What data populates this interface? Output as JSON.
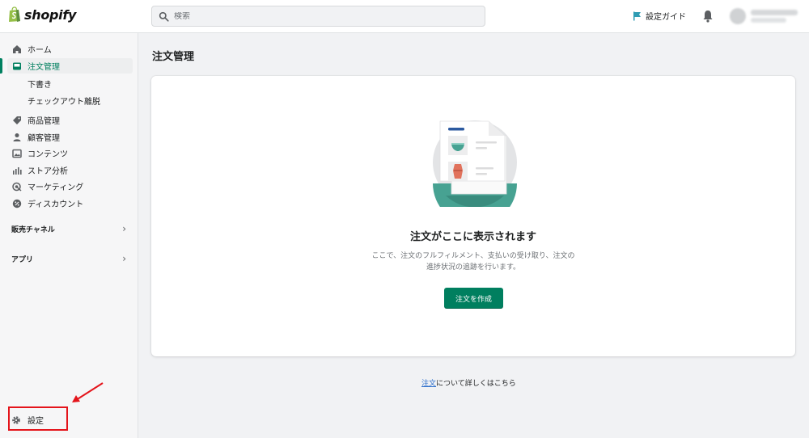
{
  "brand": {
    "name": "shopify"
  },
  "search": {
    "placeholder": "検索"
  },
  "topbar": {
    "setup_guide": "設定ガイド"
  },
  "sidebar": {
    "items": [
      {
        "label": "ホーム",
        "icon": "home-icon"
      },
      {
        "label": "注文管理",
        "icon": "orders-icon",
        "active": true
      },
      {
        "label": "商品管理",
        "icon": "tag-icon"
      },
      {
        "label": "顧客管理",
        "icon": "customer-icon"
      },
      {
        "label": "コンテンツ",
        "icon": "content-icon"
      },
      {
        "label": "ストア分析",
        "icon": "analytics-icon"
      },
      {
        "label": "マーケティング",
        "icon": "marketing-icon"
      },
      {
        "label": "ディスカウント",
        "icon": "discount-icon"
      }
    ],
    "sub_items": [
      "下書き",
      "チェックアウト離脱"
    ],
    "sections": [
      "販売チャネル",
      "アプリ"
    ],
    "settings_label": "設定"
  },
  "main": {
    "title": "注文管理",
    "empty_state": {
      "heading": "注文がここに表示されます",
      "description_line1": "ここで、注文のフルフィルメント、支払いの受け取り、注文の",
      "description_line2": "進捗状況の追跡を行います。",
      "button": "注文を作成"
    },
    "learn_more": {
      "link": "注文",
      "suffix": "について詳しくはこちら"
    }
  },
  "colors": {
    "accent": "#007f5f",
    "highlight": "#e4141b",
    "link": "#2c6ecb"
  }
}
